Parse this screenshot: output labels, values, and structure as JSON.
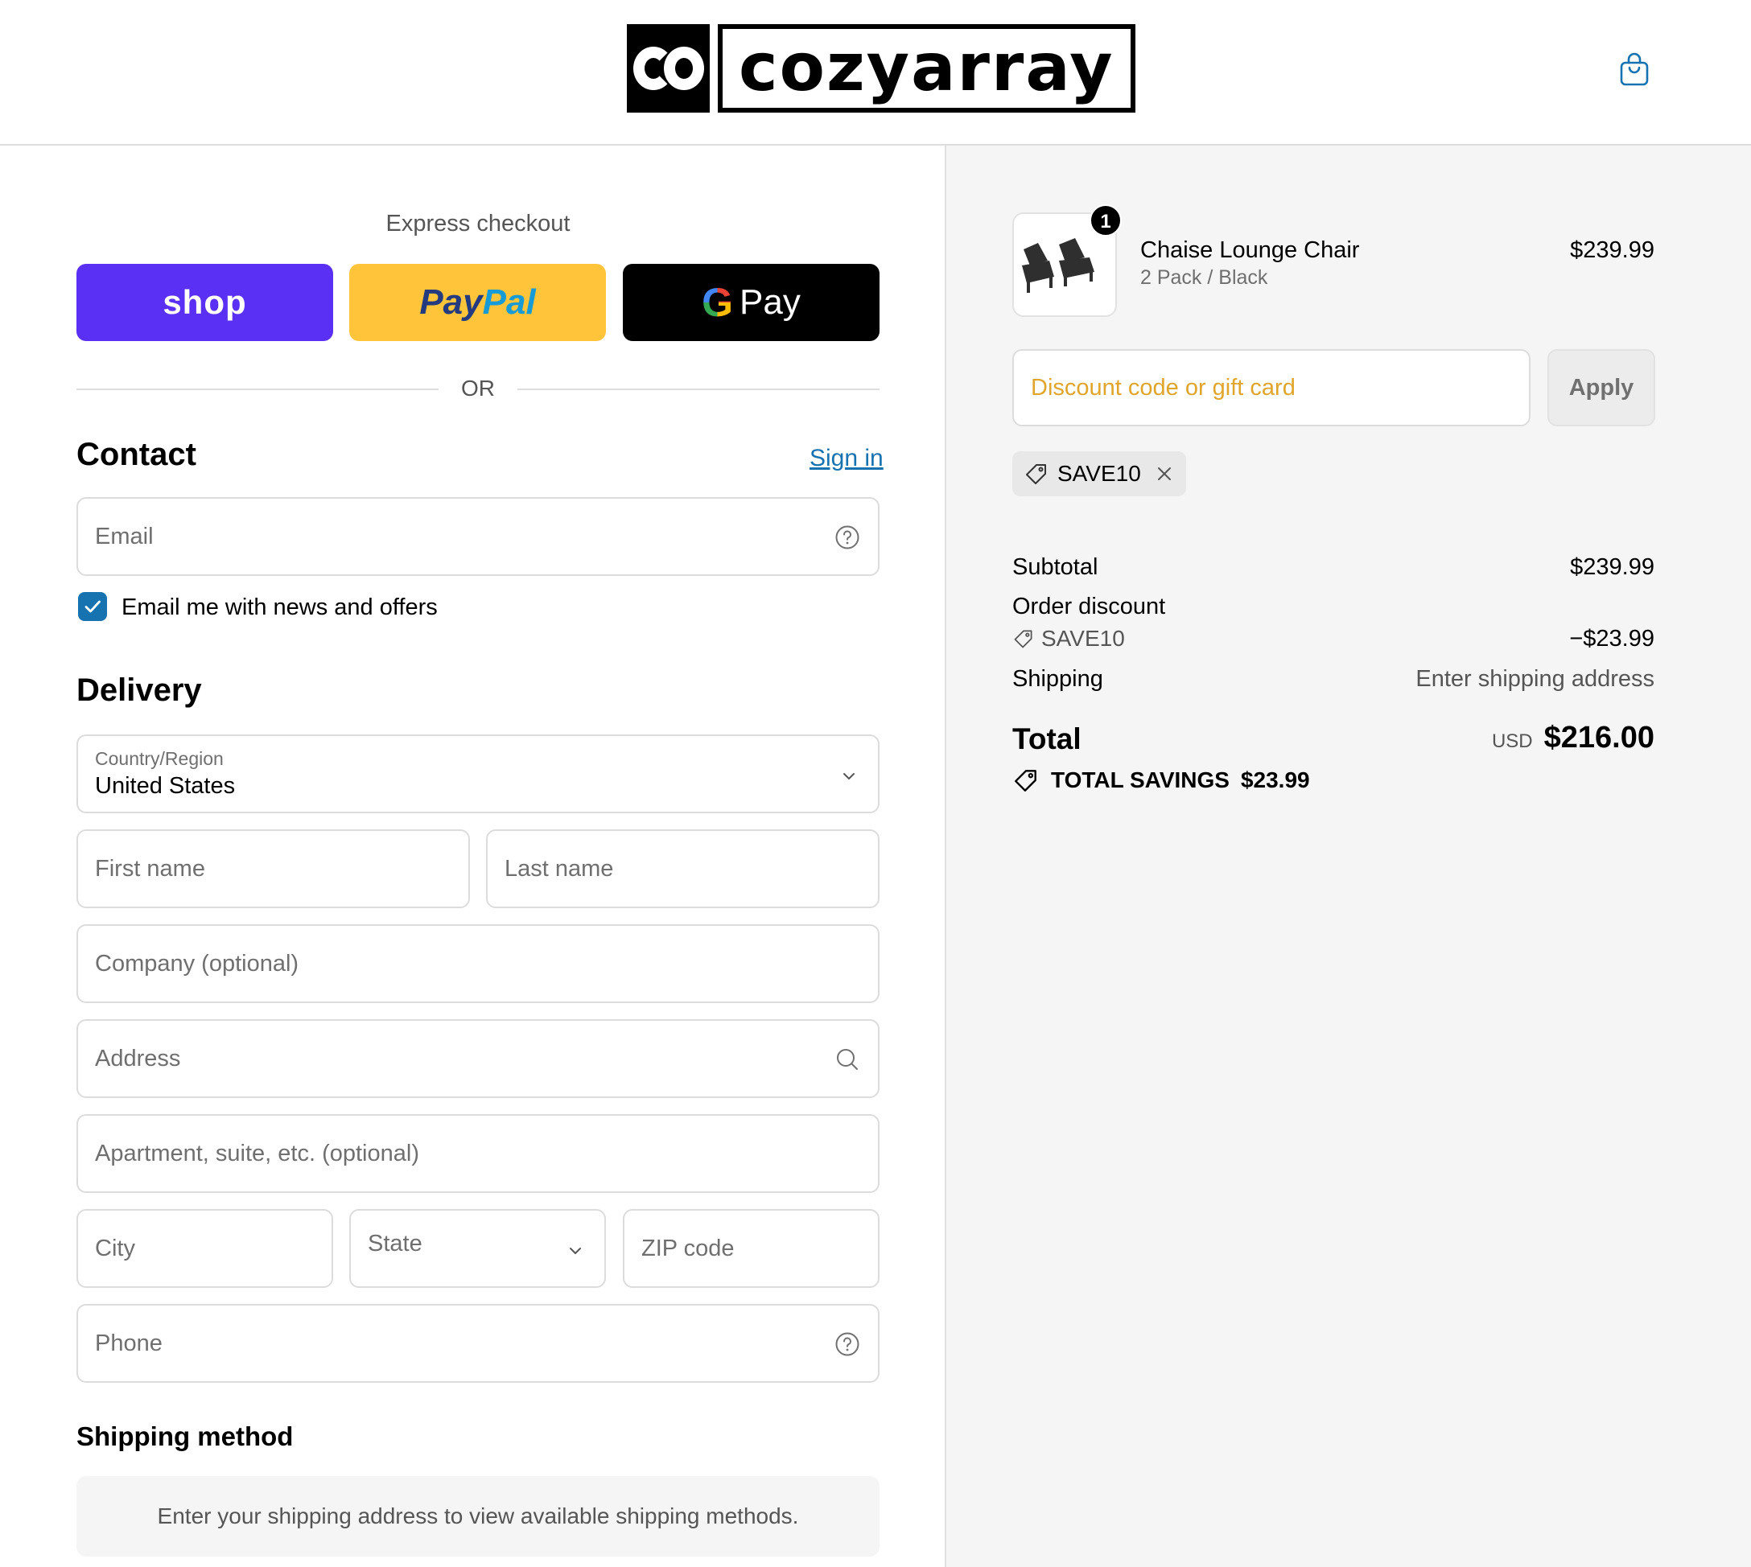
{
  "header": {
    "logo_text": "cozyarray"
  },
  "express": {
    "title": "Express checkout",
    "shop_label": "shop",
    "paypal_part1": "Pay",
    "paypal_part2": "Pal",
    "gpay_g": "G",
    "gpay_label": "Pay",
    "or_label": "OR"
  },
  "contact": {
    "heading": "Contact",
    "signin_label": "Sign in",
    "email_placeholder": "Email",
    "newsletter_label": "Email me with news and offers",
    "newsletter_checked": true
  },
  "delivery": {
    "heading": "Delivery",
    "country_label": "Country/Region",
    "country_value": "United States",
    "first_name_placeholder": "First name",
    "last_name_placeholder": "Last name",
    "company_placeholder": "Company (optional)",
    "address_placeholder": "Address",
    "apartment_placeholder": "Apartment, suite, etc. (optional)",
    "city_placeholder": "City",
    "state_placeholder": "State",
    "zip_placeholder": "ZIP code",
    "phone_placeholder": "Phone"
  },
  "shipping_method": {
    "heading": "Shipping method",
    "message": "Enter your shipping address to view available shipping methods."
  },
  "order": {
    "item": {
      "name": "Chaise Lounge Chair",
      "variant": "2 Pack / Black",
      "price": "$239.99",
      "quantity": "1"
    },
    "discount_placeholder": "Discount code or gift card",
    "apply_label": "Apply",
    "applied_code": "SAVE10",
    "subtotal_label": "Subtotal",
    "subtotal_value": "$239.99",
    "order_discount_label": "Order discount",
    "discount_code": "SAVE10",
    "discount_value": "−$23.99",
    "shipping_label": "Shipping",
    "shipping_value": "Enter shipping address",
    "total_label": "Total",
    "currency": "USD",
    "total_value": "$216.00",
    "savings_label": "TOTAL SAVINGS",
    "savings_value": "$23.99"
  },
  "colors": {
    "shop_purple": "#5a31f4",
    "paypal_yellow": "#ffc439",
    "link_blue": "#1773b0",
    "discount_placeholder": "#e0a52b"
  }
}
